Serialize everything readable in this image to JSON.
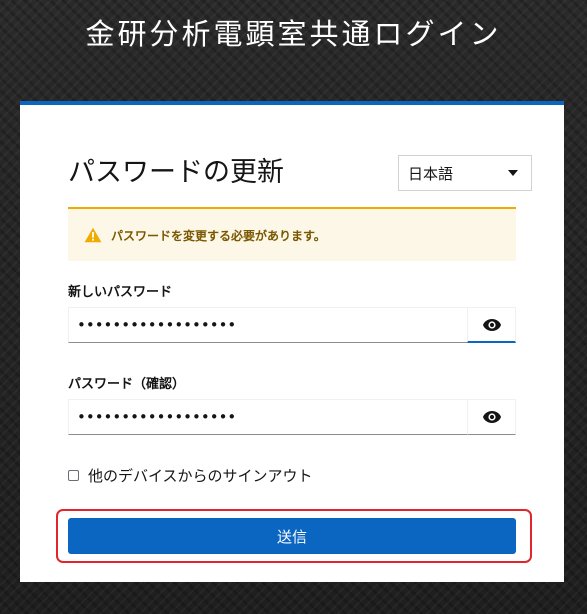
{
  "header": {
    "title": "金研分析電顕室共通ログイン"
  },
  "form": {
    "heading": "パスワードの更新",
    "language": {
      "selected": "日本語",
      "icon": "chevron-down-icon"
    },
    "alert": {
      "icon": "warning-triangle-icon",
      "text": "パスワードを変更する必要があります。",
      "color": "#f0ab00"
    },
    "new_password": {
      "label": "新しいパスワード",
      "value": "••••••••••••••••••",
      "toggle_icon": "eye-icon"
    },
    "confirm_password": {
      "label": "パスワード（確認）",
      "value": "••••••••••••••••••",
      "toggle_icon": "eye-icon"
    },
    "logout_other_devices": {
      "label": "他のデバイスからのサインアウト",
      "checked": false
    },
    "submit_label": "送信"
  },
  "colors": {
    "accent": "#0b66c2",
    "highlight": "#e0252b"
  }
}
